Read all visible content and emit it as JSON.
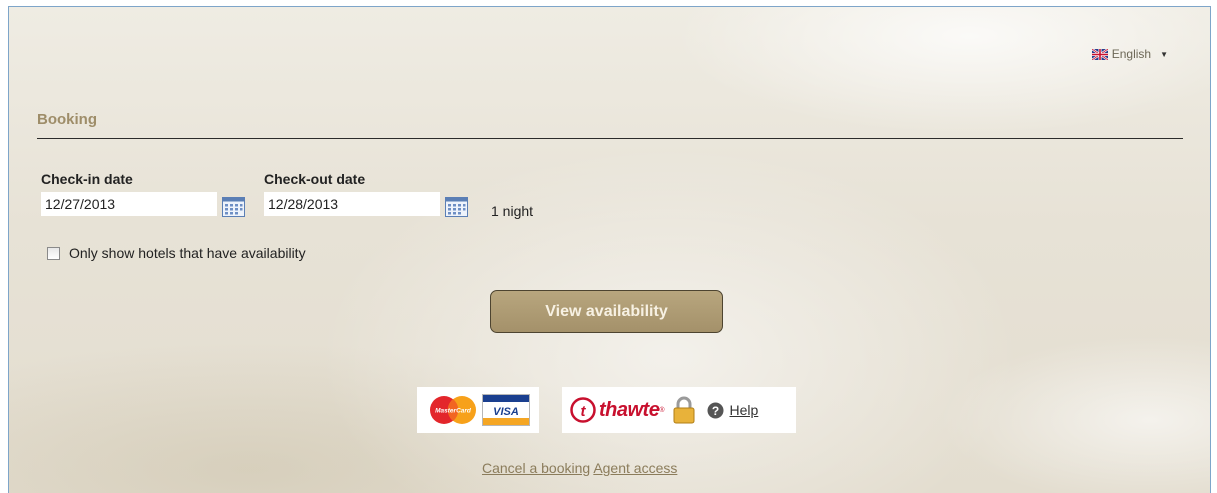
{
  "language_selector": {
    "label": "English",
    "flag_icon": "uk-flag-icon",
    "caret_icon": "caret-down-icon"
  },
  "booking": {
    "title": "Booking",
    "checkin": {
      "label": "Check-in date",
      "value": "12/27/2013"
    },
    "checkout": {
      "label": "Check-out date",
      "value": "12/28/2013"
    },
    "nights_text": "1 night",
    "availability_filter": {
      "label": "Only show hotels that have availability",
      "checked": false
    },
    "view_button": "View availability"
  },
  "trust_badges": {
    "cards": [
      "MasterCard",
      "VISA"
    ],
    "security_brand": "thawte",
    "help_label": "Help"
  },
  "footer": {
    "cancel_link": "Cancel a booking",
    "agent_link": "Agent access"
  },
  "colors": {
    "accent": "#a4916a",
    "title": "#9e8d69",
    "thawte_red": "#c8102e",
    "frame_border": "#7ea5c9"
  }
}
